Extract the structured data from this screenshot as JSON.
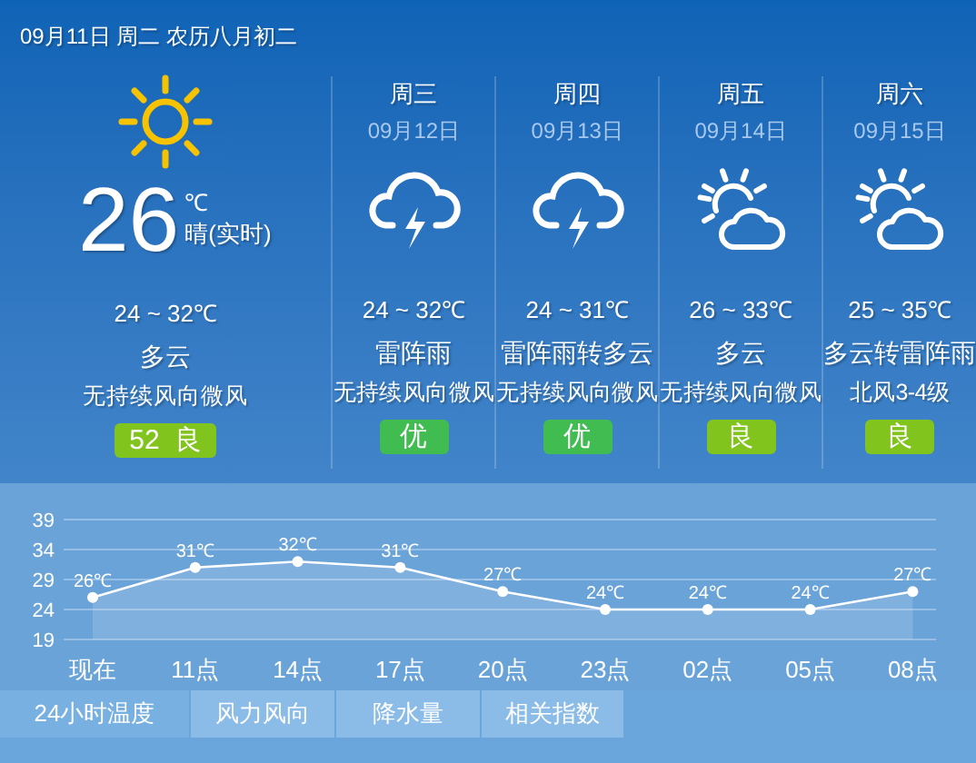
{
  "header": {
    "date": "09月11日 周二 农历八月初二"
  },
  "today": {
    "kind": "sunny",
    "temp": "26",
    "unit": "℃",
    "desc": "晴(实时)",
    "range": "24 ~ 32℃",
    "weather": "多云",
    "wind": "无持续风向微风",
    "aqi": {
      "text": "52  良",
      "color": "#82c41e"
    }
  },
  "days": [
    {
      "weekday": "周三",
      "date": "09月12日",
      "kind": "thunder",
      "range": "24 ~ 32℃",
      "weather": "雷阵雨",
      "wind": "无持续风向微风",
      "aqi": {
        "text": "优",
        "color": "#41bc50"
      }
    },
    {
      "weekday": "周四",
      "date": "09月13日",
      "kind": "thunder",
      "range": "24 ~ 31℃",
      "weather": "雷阵雨转多云",
      "wind": "无持续风向微风",
      "aqi": {
        "text": "优",
        "color": "#41bc50"
      }
    },
    {
      "weekday": "周五",
      "date": "09月14日",
      "kind": "partly_cloudy",
      "range": "26 ~ 33℃",
      "weather": "多云",
      "wind": "无持续风向微风",
      "aqi": {
        "text": "良",
        "color": "#82c41e"
      }
    },
    {
      "weekday": "周六",
      "date": "09月15日",
      "kind": "partly_cloudy",
      "range": "25 ~ 35℃",
      "weather": "多云转雷阵雨",
      "wind": "北风3-4级",
      "aqi": {
        "text": "良",
        "color": "#82c41e"
      }
    }
  ],
  "chart": {
    "chart_data": {
      "type": "area",
      "categories": [
        "现在",
        "11点",
        "14点",
        "17点",
        "20点",
        "23点",
        "02点",
        "05点",
        "08点"
      ],
      "series": [
        {
          "color": "#ffffff",
          "values": [
            26,
            31,
            32,
            31,
            27,
            24,
            24,
            24,
            27
          ]
        }
      ],
      "ylim": [
        19,
        39
      ],
      "yticks": [
        19,
        24,
        29,
        34,
        39
      ],
      "grid": true,
      "value_labels": [
        "26℃",
        "31℃",
        "32℃",
        "31℃",
        "27℃",
        "24℃",
        "24℃",
        "24℃",
        "27℃"
      ]
    }
  },
  "tabs": [
    {
      "label": "24小时温度",
      "selected": true
    },
    {
      "label": "风力风向",
      "selected": false
    },
    {
      "label": "降水量",
      "selected": false
    },
    {
      "label": "相关指数",
      "selected": false
    }
  ]
}
